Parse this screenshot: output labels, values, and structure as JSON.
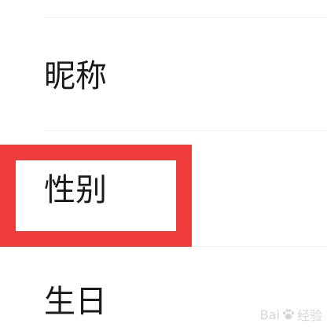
{
  "settings_list": {
    "items": [
      {
        "label": "昵称"
      },
      {
        "label": "性别"
      },
      {
        "label": "生日"
      }
    ]
  },
  "highlight": {
    "color": "#ee3b3b",
    "target": "性别"
  },
  "watermark": {
    "text_left": "Bai",
    "icon": "paw-icon",
    "text_right": "经验",
    "color": "#d6d6d6"
  }
}
